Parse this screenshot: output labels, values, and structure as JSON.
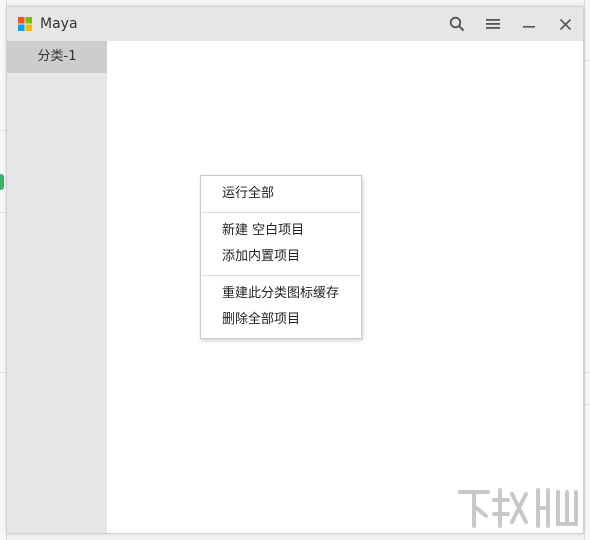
{
  "window": {
    "title": "Maya",
    "icons": [
      "windows-logo-icon",
      "search-icon",
      "menu-icon",
      "minimize-icon",
      "close-icon"
    ]
  },
  "sidebar": {
    "categories": [
      {
        "label": "分类-1",
        "selected": true
      }
    ]
  },
  "context_menu": {
    "groups": [
      [
        "运行全部"
      ],
      [
        "新建 空白项目",
        "添加内置项目"
      ],
      [
        "重建此分类图标缓存",
        "删除全部项目"
      ]
    ]
  },
  "colors": {
    "titlebar": "#e6e6e6",
    "sidebar": "#e6e6e6",
    "selected_category": "#cdcdcd",
    "content": "#ffffff"
  }
}
